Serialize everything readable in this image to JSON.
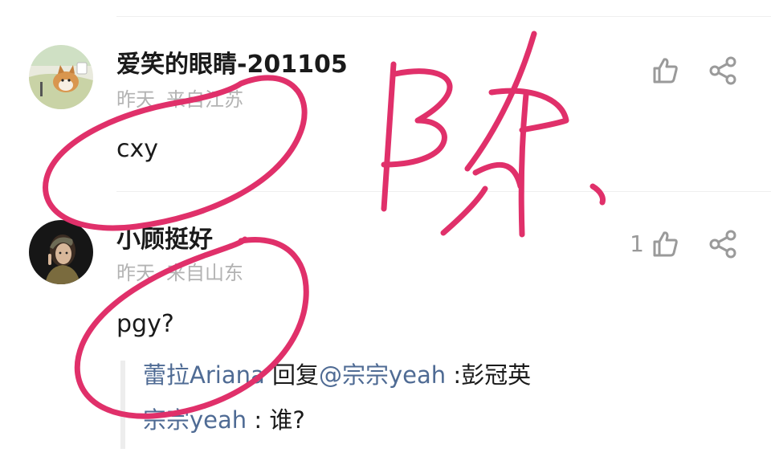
{
  "comments": [
    {
      "username": "爱笑的眼睛-201105",
      "time": "昨天",
      "location": "来自江苏",
      "text": "cxy",
      "like_count": "",
      "avatar_icon": "corgi-avatar"
    },
    {
      "username": "小顾挺好",
      "time": "昨天",
      "location": "来自山东",
      "text": "pgy?",
      "like_count": "1",
      "avatar_icon": "girl-avatar",
      "replies": [
        {
          "author": "蕾拉Ariana",
          "verb": "回复",
          "target": "@宗宗yeah",
          "separator": " :",
          "content": "彭冠英"
        },
        {
          "author": "宗宗yeah",
          "separator": " : ",
          "content": "谁?"
        }
      ]
    }
  ],
  "handwritten_overlay": {
    "text": "陈",
    "ink_color": "#e0306a"
  }
}
